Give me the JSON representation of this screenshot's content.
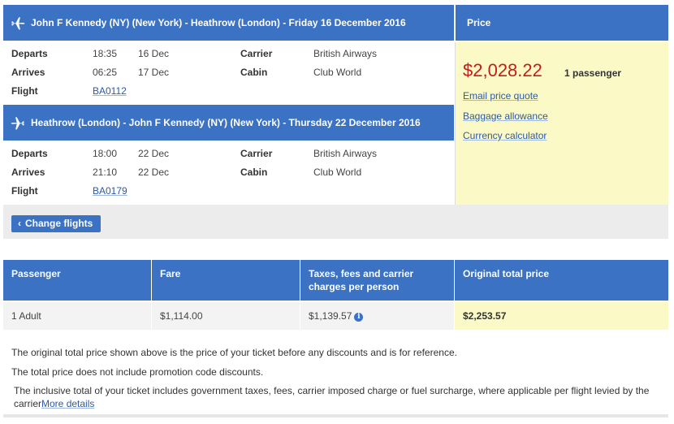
{
  "outbound": {
    "header": "John F Kennedy (NY) (New York) - Heathrow (London) - Friday 16 December 2016",
    "departs_label": "Departs",
    "departs_time": "18:35",
    "departs_date": "16 Dec",
    "arrives_label": "Arrives",
    "arrives_time": "06:25",
    "arrives_date": "17 Dec",
    "flight_label": "Flight",
    "flight_number": "BA0112",
    "carrier_label": "Carrier",
    "carrier": "British Airways",
    "cabin_label": "Cabin",
    "cabin": "Club World"
  },
  "inbound": {
    "header": "Heathrow (London) - John F Kennedy (NY) (New York) - Thursday 22 December 2016",
    "departs_label": "Departs",
    "departs_time": "18:00",
    "departs_date": "22 Dec",
    "arrives_label": "Arrives",
    "arrives_time": "21:10",
    "arrives_date": "22 Dec",
    "flight_label": "Flight",
    "flight_number": "BA0179",
    "carrier_label": "Carrier",
    "carrier": "British Airways",
    "cabin_label": "Cabin",
    "cabin": "Club World"
  },
  "price": {
    "header": "Price",
    "amount": "$2,028.22",
    "passengers": "1 passenger",
    "links": [
      "Email price quote",
      "Baggage allowance",
      "Currency calculator"
    ],
    "amount_color": "#c0201b"
  },
  "change_flights_label": "Change flights",
  "fare_table": {
    "headers": [
      "Passenger",
      "Fare",
      "Taxes, fees and carrier charges per person",
      "Original total price"
    ],
    "row": [
      "1 Adult",
      "$1,114.00",
      "$1,139.57",
      "$2,253.57"
    ]
  },
  "notes": [
    "The original total price shown above is the price of your ticket before any discounts and is for reference.",
    "The total price does not include promotion code discounts.",
    "The inclusive total of your ticket includes government taxes, fees, carrier imposed charge or fuel surcharge, where applicable per flight levied by the carrier"
  ],
  "more_details_label": "More details",
  "colors": {
    "header_blue": "#3b72c4",
    "price_bg": "#fbf9c6"
  }
}
